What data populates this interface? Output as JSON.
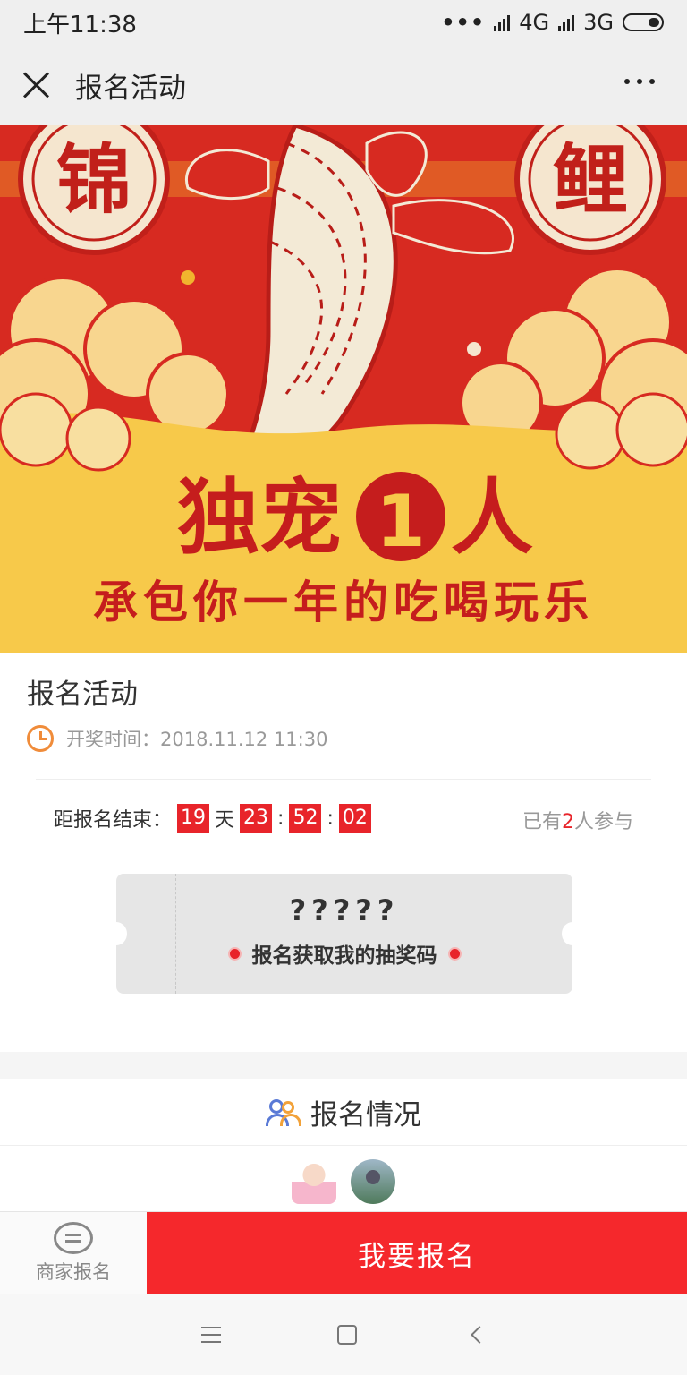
{
  "status_bar": {
    "time": "上午11:38",
    "network1": "4G",
    "network2": "3G"
  },
  "header": {
    "title": "报名活动"
  },
  "banner": {
    "seal_left": "锦",
    "seal_right": "鲤",
    "headline_a": "独宠",
    "headline_num": "1",
    "headline_b": "人",
    "subline": "承包你一年的吃喝玩乐"
  },
  "event": {
    "title": "报名活动",
    "draw_time": "开奖时间：2018.11.12 11:30",
    "countdown_label": "距报名结束：",
    "days": "19",
    "days_unit": "天",
    "hours": "23",
    "minutes": "52",
    "seconds": "02",
    "sep": ":",
    "participants_prefix": "已有",
    "participants_count": "2",
    "participants_suffix": "人参与"
  },
  "ticket": {
    "code": "?????",
    "hint": "报名获取我的抽奖码"
  },
  "registration": {
    "title": "报名情况"
  },
  "bottom_bar": {
    "merchant_label": "商家报名",
    "signup_label": "我要报名"
  },
  "colors": {
    "accent": "#e8242a",
    "banner_red": "#d72a21",
    "banner_yellow": "#f7c94a"
  }
}
